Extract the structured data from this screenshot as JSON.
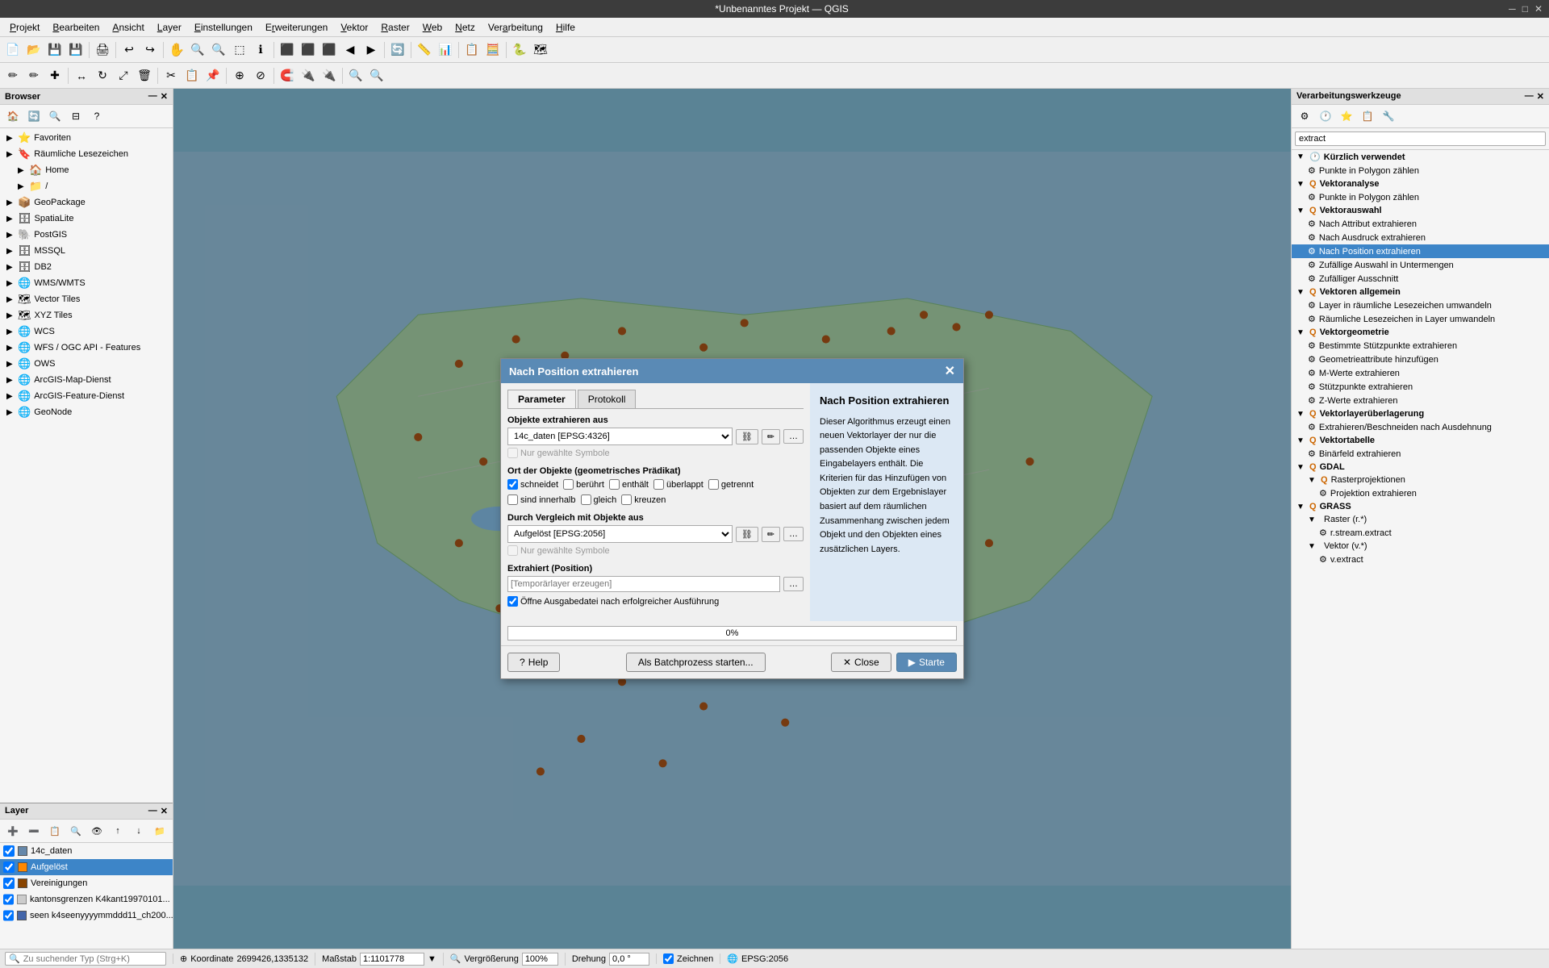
{
  "window": {
    "title": "*Unbenanntes Projekt — QGIS"
  },
  "menubar": {
    "items": [
      "Projekt",
      "Bearbeiten",
      "Ansicht",
      "Layer",
      "Einstellungen",
      "Erweiterungen",
      "Vektor",
      "Raster",
      "Web",
      "Netz",
      "Verarbeitung",
      "Hilfe"
    ]
  },
  "browser": {
    "title": "Browser",
    "items": [
      {
        "label": "Favoriten",
        "icon": "⭐",
        "arrow": "▶",
        "level": 0
      },
      {
        "label": "Räumliche Lesezeichen",
        "icon": "🔖",
        "arrow": "▶",
        "level": 0
      },
      {
        "label": "Home",
        "icon": "🏠",
        "arrow": "▶",
        "level": 1
      },
      {
        "label": "/",
        "icon": "📁",
        "arrow": "▶",
        "level": 1
      },
      {
        "label": "GeoPackage",
        "icon": "📦",
        "arrow": "▶",
        "level": 0
      },
      {
        "label": "SpatiaLite",
        "icon": "🗄",
        "arrow": "▶",
        "level": 0
      },
      {
        "label": "PostGIS",
        "icon": "🐘",
        "arrow": "▶",
        "level": 0
      },
      {
        "label": "MSSQL",
        "icon": "🗄",
        "arrow": "▶",
        "level": 0
      },
      {
        "label": "DB2",
        "icon": "🗄",
        "arrow": "▶",
        "level": 0
      },
      {
        "label": "WMS/WMTS",
        "icon": "🌐",
        "arrow": "▶",
        "level": 0
      },
      {
        "label": "Vector Tiles",
        "icon": "🗺",
        "arrow": "▶",
        "level": 0
      },
      {
        "label": "XYZ Tiles",
        "icon": "🗺",
        "arrow": "▶",
        "level": 0
      },
      {
        "label": "WCS",
        "icon": "🌐",
        "arrow": "▶",
        "level": 0
      },
      {
        "label": "WFS / OGC API - Features",
        "icon": "🌐",
        "arrow": "▶",
        "level": 0
      },
      {
        "label": "OWS",
        "icon": "🌐",
        "arrow": "▶",
        "level": 0
      },
      {
        "label": "ArcGIS-Map-Dienst",
        "icon": "🌐",
        "arrow": "▶",
        "level": 0
      },
      {
        "label": "ArcGIS-Feature-Dienst",
        "icon": "🌐",
        "arrow": "▶",
        "level": 0
      },
      {
        "label": "GeoNode",
        "icon": "🌐",
        "arrow": "▶",
        "level": 0
      }
    ]
  },
  "layers": {
    "title": "Layer",
    "items": [
      {
        "label": "14c_daten",
        "color": "#6688aa",
        "checked": true,
        "selected": false
      },
      {
        "label": "Aufgelöst",
        "color": "#ff8800",
        "checked": true,
        "selected": true
      },
      {
        "label": "Vereinigungen",
        "color": "#884400",
        "checked": true,
        "selected": false
      },
      {
        "label": "kantonsgrenzen K4kant19970101...",
        "color": "#cccccc",
        "checked": true,
        "selected": false
      },
      {
        "label": "seen k4seenyyyymmddd11_ch200...",
        "color": "#4466aa",
        "checked": true,
        "selected": false
      }
    ]
  },
  "processing": {
    "title": "Verarbeitungswerkzeuge",
    "search_placeholder": "extract",
    "tree": [
      {
        "label": "Kürzlich verwendet",
        "icon": "🕐",
        "arrow": "▼",
        "level": 0,
        "expanded": true
      },
      {
        "label": "Punkte in Polygon zählen",
        "icon": "⚙",
        "arrow": "",
        "level": 1
      },
      {
        "label": "Vektoranalyse",
        "icon": "Q",
        "arrow": "▼",
        "level": 0,
        "expanded": true
      },
      {
        "label": "Punkte in Polygon zählen",
        "icon": "⚙",
        "arrow": "",
        "level": 1
      },
      {
        "label": "Vektorauswahl",
        "icon": "Q",
        "arrow": "▼",
        "level": 0,
        "expanded": true
      },
      {
        "label": "Nach Attribut extrahieren",
        "icon": "⚙",
        "arrow": "",
        "level": 1
      },
      {
        "label": "Nach Ausdruck extrahieren",
        "icon": "⚙",
        "arrow": "",
        "level": 1
      },
      {
        "label": "Nach Position extrahieren",
        "icon": "⚙",
        "arrow": "",
        "level": 1,
        "selected": true
      },
      {
        "label": "Zufällige Auswahl in Untermengen",
        "icon": "⚙",
        "arrow": "",
        "level": 1
      },
      {
        "label": "Zufälliger Ausschnitt",
        "icon": "⚙",
        "arrow": "",
        "level": 1
      },
      {
        "label": "Vektoren allgemein",
        "icon": "Q",
        "arrow": "▼",
        "level": 0,
        "expanded": true
      },
      {
        "label": "Layer in räumliche Lesezeichen umwandeln",
        "icon": "⚙",
        "arrow": "",
        "level": 1
      },
      {
        "label": "Räumliche Lesezeichen in Layer umwandeln",
        "icon": "⚙",
        "arrow": "",
        "level": 1
      },
      {
        "label": "Vektorgeometrie",
        "icon": "Q",
        "arrow": "▼",
        "level": 0,
        "expanded": true
      },
      {
        "label": "Bestimmte Stützpunkte extrahieren",
        "icon": "⚙",
        "arrow": "",
        "level": 1
      },
      {
        "label": "Geometrieattribute hinzufügen",
        "icon": "⚙",
        "arrow": "",
        "level": 1
      },
      {
        "label": "M-Werte extrahieren",
        "icon": "⚙",
        "arrow": "",
        "level": 1
      },
      {
        "label": "Stützpunkte extrahieren",
        "icon": "⚙",
        "arrow": "",
        "level": 1
      },
      {
        "label": "Z-Werte extrahieren",
        "icon": "⚙",
        "arrow": "",
        "level": 1
      },
      {
        "label": "Vektorlayerüberlagerung",
        "icon": "Q",
        "arrow": "▼",
        "level": 0,
        "expanded": true
      },
      {
        "label": "Extrahieren/Beschneiden nach Ausdehnung",
        "icon": "⚙",
        "arrow": "",
        "level": 1
      },
      {
        "label": "Vektortabelle",
        "icon": "Q",
        "arrow": "▼",
        "level": 0,
        "expanded": true
      },
      {
        "label": "Binärfeld extrahieren",
        "icon": "⚙",
        "arrow": "",
        "level": 1
      },
      {
        "label": "GDAL",
        "icon": "Q",
        "arrow": "▼",
        "level": 0,
        "expanded": true
      },
      {
        "label": "Rasterprojektionen",
        "icon": "Q",
        "arrow": "▼",
        "level": 1,
        "expanded": true
      },
      {
        "label": "Projektion extrahieren",
        "icon": "⚙",
        "arrow": "",
        "level": 2
      },
      {
        "label": "GRASS",
        "icon": "Q",
        "arrow": "▼",
        "level": 0,
        "expanded": true
      },
      {
        "label": "Raster (r.*)",
        "icon": "",
        "arrow": "▼",
        "level": 1,
        "expanded": true
      },
      {
        "label": "r.stream.extract",
        "icon": "⚙",
        "arrow": "",
        "level": 2
      },
      {
        "label": "Vektor (v.*)",
        "icon": "",
        "arrow": "▼",
        "level": 1,
        "expanded": true
      },
      {
        "label": "v.extract",
        "icon": "⚙",
        "arrow": "",
        "level": 2
      }
    ]
  },
  "dialog": {
    "title": "Nach Position extrahieren",
    "tabs": [
      "Parameter",
      "Protokoll"
    ],
    "active_tab": "Parameter",
    "section1_label": "Objekte extrahieren aus",
    "layer1_value": "14c_daten [EPSG:4326]",
    "checkbox1_label": "Nur gewählte Symbole",
    "section2_label": "Ort der Objekte (geometrisches Prädikat)",
    "predicates": [
      {
        "label": "schneidet",
        "checked": true
      },
      {
        "label": "berührt",
        "checked": false
      },
      {
        "label": "enthält",
        "checked": false
      },
      {
        "label": "überlappt",
        "checked": false
      },
      {
        "label": "getrennt",
        "checked": false
      },
      {
        "label": "sind innerhalb",
        "checked": false
      },
      {
        "label": "gleich",
        "checked": false
      },
      {
        "label": "kreuzen",
        "checked": false
      }
    ],
    "section3_label": "Durch Vergleich mit Objekte aus",
    "layer2_value": "Aufgelöst [EPSG:2056]",
    "checkbox2_label": "Nur gewählte Symbole",
    "section4_label": "Extrahiert (Position)",
    "output_placeholder": "[Temporärlayer erzeugen]",
    "open_output_label": "Öffne Ausgabedatei nach erfolgreicher Ausführung",
    "progress_text": "0%",
    "btn_help": "Help",
    "btn_batch": "Als Batchprozess starten...",
    "btn_close": "✗ Close",
    "btn_start": "▶ Starte",
    "description_title": "Nach Position extrahieren",
    "description": "Dieser Algorithmus erzeugt einen neuen Vektorlayer der nur die passenden Objekte eines Eingabelayers enthält. Die Kriterien für das Hinzufügen von Objekten zur dem Ergebnislayer basiert auf dem räumlichen Zusammenhang zwischen jedem Objekt und den Objekten eines zusätzlichen Layers."
  },
  "statusbar": {
    "search_placeholder": "Zu suchender Typ (Strg+K)",
    "coordinate_label": "Koordinate",
    "coordinate_value": "2699426,1335132",
    "scale_label": "Maßstab",
    "scale_value": "1:1101778",
    "zoom_label": "Vergrößerung",
    "zoom_value": "100%",
    "rotation_label": "Drehung",
    "rotation_value": "0,0 °",
    "render_label": "Zeichnen",
    "epsg_label": "EPSG:2056"
  }
}
